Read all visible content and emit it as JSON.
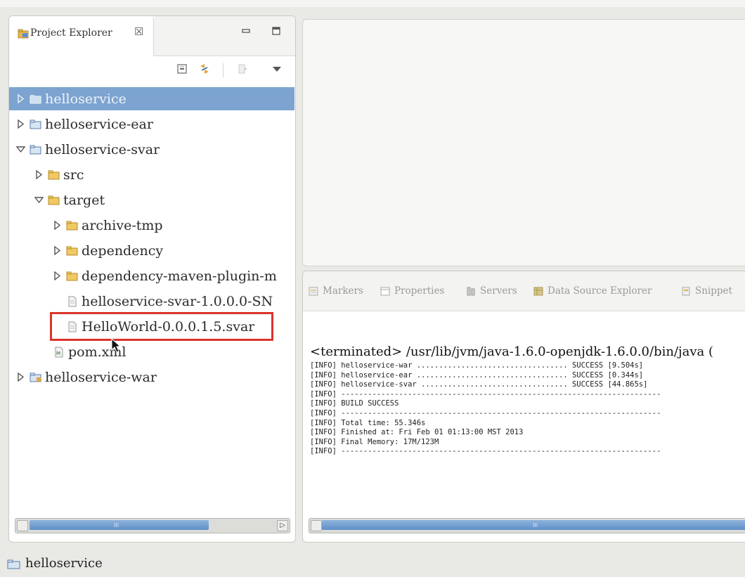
{
  "project_explorer": {
    "title": "Project Explorer",
    "close_glyph": "☒",
    "icons": [
      "project-explorer-icon",
      "minimize-icon",
      "maximize-icon",
      "collapse-all-icon",
      "link-with-editor-icon",
      "view-menu-icon"
    ],
    "tree": [
      {
        "label": "helloservice",
        "type": "project",
        "expanded": false,
        "selected": true
      },
      {
        "label": "helloservice-ear",
        "type": "project",
        "expanded": false,
        "selected": false
      },
      {
        "label": "helloservice-svar",
        "type": "project",
        "expanded": true,
        "selected": false
      },
      {
        "label": "src",
        "type": "folder",
        "expanded": false,
        "selected": false
      },
      {
        "label": "target",
        "type": "folder",
        "expanded": true,
        "selected": false
      },
      {
        "label": "archive-tmp",
        "type": "folder",
        "expanded": false,
        "selected": false
      },
      {
        "label": "dependency",
        "type": "folder",
        "expanded": false,
        "selected": false
      },
      {
        "label": "dependency-maven-plugin-m",
        "type": "folder",
        "expanded": false,
        "selected": false
      },
      {
        "label": "helloservice-svar-1.0.0.0-SN",
        "type": "file",
        "expanded": null,
        "selected": false
      },
      {
        "label": "HelloWorld-0.0.0.1.5.svar",
        "type": "file",
        "expanded": null,
        "selected": false,
        "highlighted": true
      },
      {
        "label": "pom.xml",
        "type": "xml-file",
        "expanded": null,
        "selected": false
      },
      {
        "label": "helloservice-war",
        "type": "project",
        "expanded": false,
        "selected": false
      }
    ],
    "scrollbar_grip": "III"
  },
  "console": {
    "tabs": [
      {
        "label": "Markers",
        "icon": "markers-icon"
      },
      {
        "label": "Properties",
        "icon": "properties-icon"
      },
      {
        "label": "Servers",
        "icon": "servers-icon"
      },
      {
        "label": "Data Source Explorer",
        "icon": "data-source-icon"
      },
      {
        "label": "Snippet",
        "icon": "snippets-icon"
      }
    ],
    "header": "<terminated> /usr/lib/jvm/java-1.6.0-openjdk-1.6.0.0/bin/java (",
    "log": [
      "[INFO] helloservice-war .................................. SUCCESS [9.504s]",
      "[INFO] helloservice-ear .................................. SUCCESS [0.344s]",
      "[INFO] helloservice-svar ................................. SUCCESS [44.865s]",
      "[INFO] ------------------------------------------------------------------------",
      "[INFO] BUILD SUCCESS",
      "[INFO] ------------------------------------------------------------------------",
      "[INFO] Total time: 55.346s",
      "[INFO] Finished at: Fri Feb 01 01:13:00 MST 2013",
      "[INFO] Final Memory: 17M/123M",
      "[INFO] ------------------------------------------------------------------------"
    ],
    "scrollbar_grip": "III"
  },
  "status_bar": {
    "text": "helloservice",
    "icon": "project-folder-icon"
  },
  "colors": {
    "selection": "#7da4d0",
    "highlight_box": "#d9342b",
    "scroll_thumb": "#6f9bd0",
    "background": "#e9e9e6"
  }
}
